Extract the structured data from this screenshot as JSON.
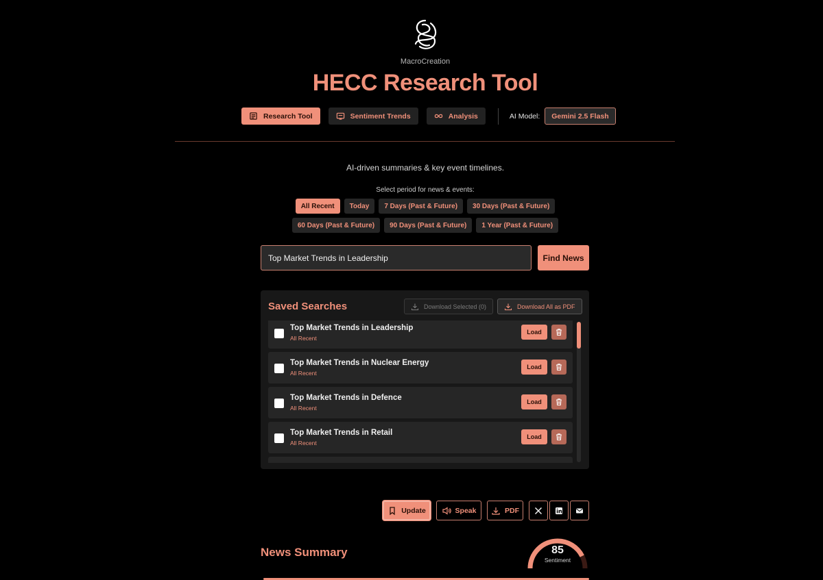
{
  "header": {
    "brand": "MacroCreation",
    "title": "HECC Research Tool"
  },
  "nav": {
    "tabs": [
      {
        "label": "Research Tool",
        "icon": "newspaper-icon",
        "active": true
      },
      {
        "label": "Sentiment Trends",
        "icon": "monitor-icon",
        "active": false
      },
      {
        "label": "Analysis",
        "icon": "infinity-icon",
        "active": false
      }
    ],
    "model_label": "AI Model:",
    "model_value": "Gemini 2.5 Flash"
  },
  "tagline": "AI-driven summaries & key event timelines.",
  "period": {
    "label": "Select period for news & events:",
    "row1": [
      "All Recent",
      "Today",
      "7 Days (Past & Future)",
      "30 Days (Past & Future)"
    ],
    "row2": [
      "60 Days (Past & Future)",
      "90 Days (Past & Future)",
      "1 Year (Past & Future)"
    ],
    "selected": "All Recent"
  },
  "search": {
    "value": "Top Market Trends in Leadership",
    "button": "Find News"
  },
  "saved": {
    "title": "Saved Searches",
    "download_selected": "Download Selected (0)",
    "download_all": "Download All as PDF",
    "load_label": "Load",
    "items": [
      {
        "title": "Top Market Trends in Leadership",
        "period": "All Recent"
      },
      {
        "title": "Top Market Trends in Nuclear Energy",
        "period": "All Recent"
      },
      {
        "title": "Top Market Trends in Defence",
        "period": "All Recent"
      },
      {
        "title": "Top Market Trends in Retail",
        "period": "All Recent"
      }
    ]
  },
  "actions": {
    "update": "Update",
    "speak": "Speak",
    "pdf": "PDF"
  },
  "news": {
    "title": "News Summary",
    "sentiment_value": "85",
    "sentiment_label": "Sentiment",
    "sentiment_fraction": 0.85
  },
  "colors": {
    "accent": "#f0907a",
    "background": "#000000",
    "panel": "#181818"
  }
}
